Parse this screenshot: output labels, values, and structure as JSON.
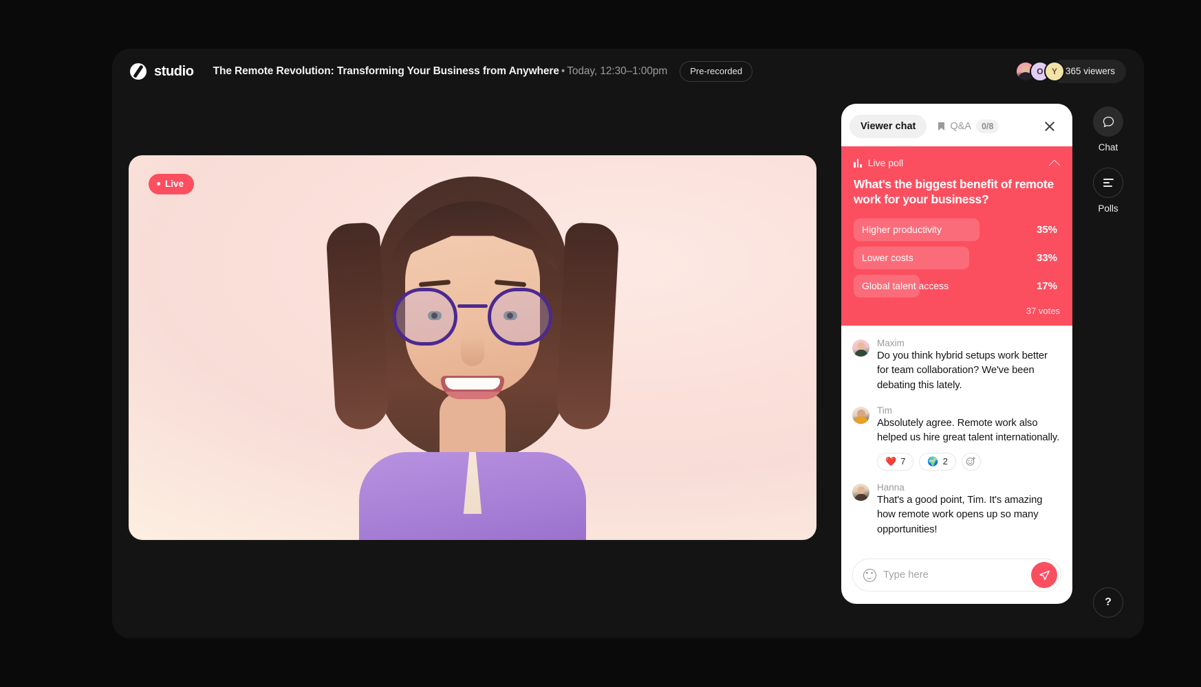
{
  "brand": {
    "name": "studio",
    "logo_icon": "studio-disc-logo"
  },
  "header": {
    "session_title": "The Remote Revolution: Transforming Your Business from Anywhere",
    "separator": "•",
    "session_time": "Today, 12:30–1:00pm",
    "status_badge": "Pre-recorded",
    "viewers": "365 viewers",
    "avatars": [
      {
        "initial": "",
        "type": "photo"
      },
      {
        "initial": "O",
        "type": "lilac"
      },
      {
        "initial": "Y",
        "type": "cream"
      }
    ]
  },
  "stage": {
    "live_badge": "Live"
  },
  "chat": {
    "tabs": [
      {
        "label": "Viewer chat",
        "active": true
      },
      {
        "label": "Q&A",
        "active": false,
        "icon": "bookmark-icon",
        "count": "0/8"
      }
    ],
    "close_icon": "close-icon",
    "messages": [
      {
        "author": "Maxim",
        "text": "Do you think hybrid setups work better for team collaboration? We've been debating this lately.",
        "reactions": []
      },
      {
        "author": "Tim",
        "text": "Absolutely agree. Remote work also helped us hire great talent internationally.",
        "reactions": [
          {
            "emoji": "❤️",
            "count": "7"
          },
          {
            "emoji": "🌍",
            "count": "2"
          }
        ],
        "add_reaction_icon": "add-reaction-icon"
      },
      {
        "author": "Hanna",
        "text": "That's a good point, Tim. It's amazing how remote work opens up so many opportunities!",
        "reactions": []
      }
    ],
    "composer": {
      "placeholder": "Type here",
      "value": "",
      "emoji_icon": "emoji-icon",
      "send_icon": "send-icon"
    }
  },
  "poll": {
    "label": "Live poll",
    "chart_icon": "bar-chart-icon",
    "collapse_icon": "chevron-up-icon",
    "question": "What's the biggest benefit of remote work for your business?",
    "votes": "37 votes",
    "accent_color": "#fb4f60"
  },
  "chart_data": {
    "type": "bar",
    "title": "What's the biggest benefit of remote work for your business?",
    "categories": [
      "Higher productivity",
      "Lower costs",
      "Global talent access"
    ],
    "values": [
      35,
      33,
      17
    ],
    "value_labels": [
      "35%",
      "33%",
      "17%"
    ],
    "bar_widths_pct": [
      61,
      56,
      32
    ],
    "total_label": "37 votes",
    "xlabel": "",
    "ylabel": "",
    "ylim": [
      0,
      100
    ],
    "legend": false,
    "grid": false,
    "orientation": "horizontal"
  },
  "rail": {
    "items": [
      {
        "label": "Chat",
        "icon": "chat-bubble-icon",
        "active": true
      },
      {
        "label": "Polls",
        "icon": "polls-bars-icon",
        "active": false
      }
    ],
    "help_label": "?"
  }
}
